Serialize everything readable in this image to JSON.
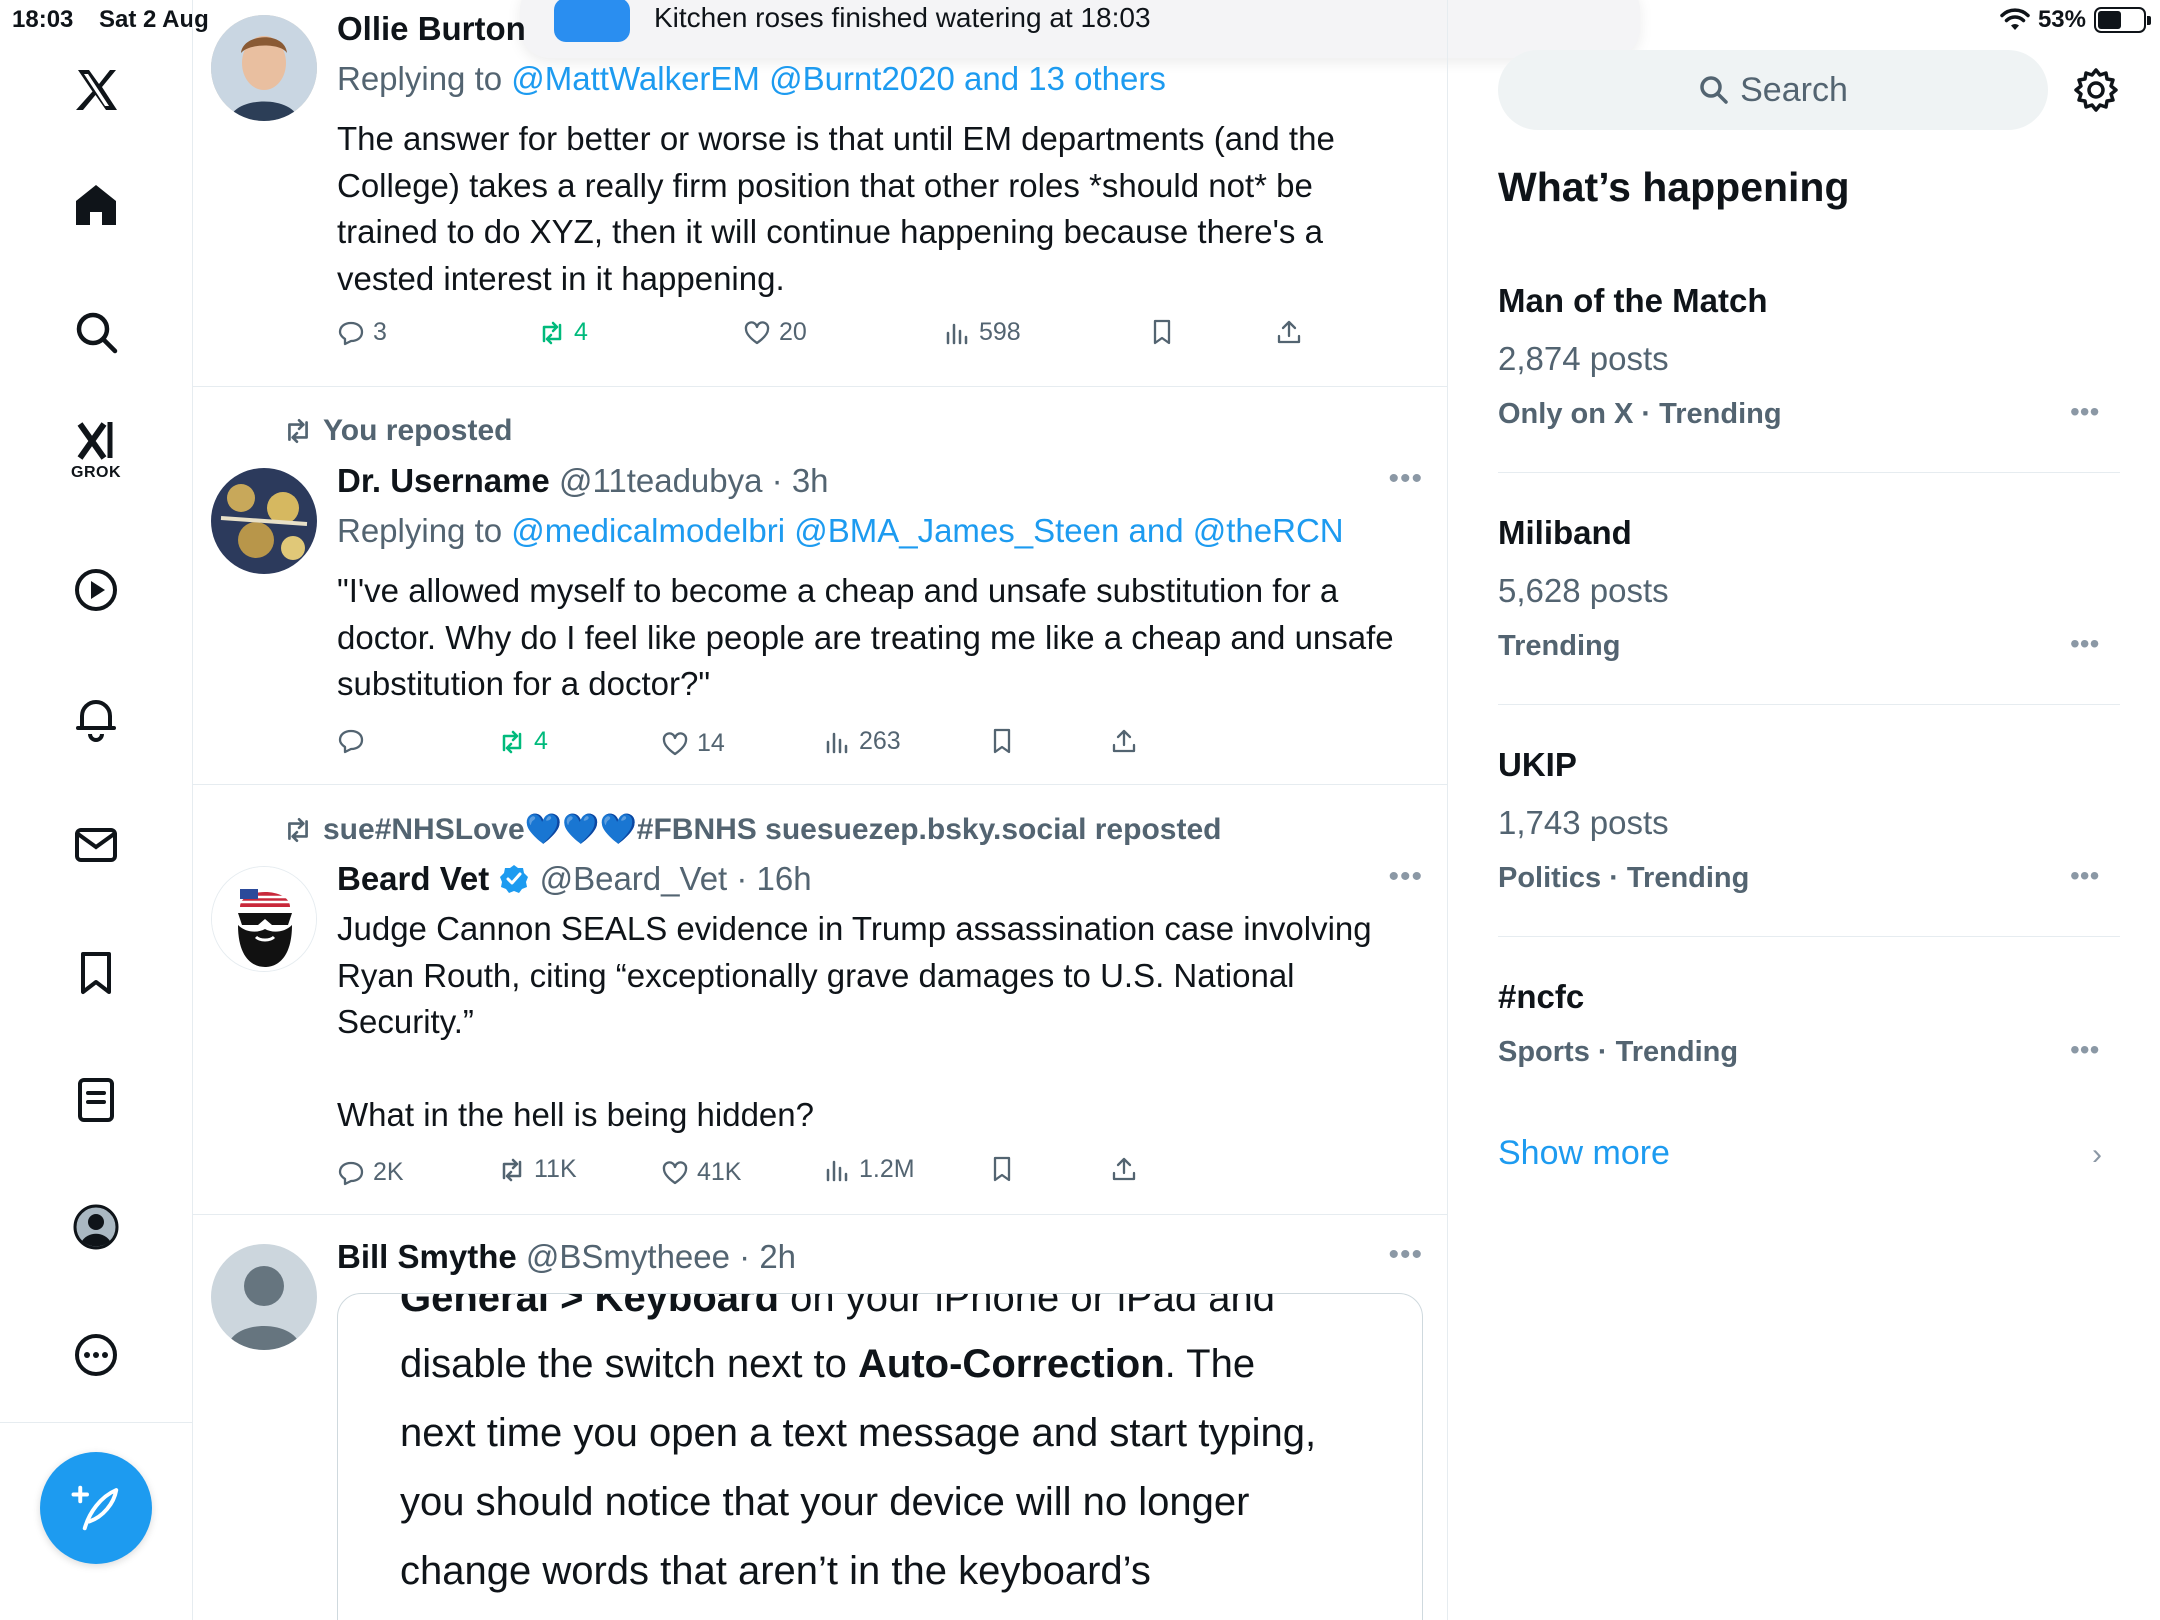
{
  "status_bar": {
    "time": "18:03",
    "date": "Sat 2 Aug",
    "battery_percent": "53%",
    "battery_level": 0.53
  },
  "notification": {
    "text": "Kitchen roses finished watering at 18:03"
  },
  "left_nav": {
    "items": [
      "x-logo",
      "home",
      "explore",
      "grok",
      "videos",
      "notifications",
      "messages",
      "bookmarks",
      "lists",
      "profile",
      "more"
    ],
    "grok_label": "GROK"
  },
  "feed": {
    "tweets": [
      {
        "name": "Ollie Burton",
        "replying_label": "Replying to",
        "replying_to": "@MattWalkerEM @Burnt2020 and 13 others",
        "body_lines": [
          "The answer for better or worse is that until EM departments (and the",
          "College) takes a really firm position that other roles *should not* be",
          "trained to do XYZ, then it will continue happening because there's a",
          "vested interest in it happening."
        ],
        "replies": "3",
        "reposts": "4",
        "likes": "20",
        "views": "598"
      },
      {
        "repost_context": "You reposted",
        "name": "Dr. Username",
        "handle": "@11teadubya",
        "time": "3h",
        "replying_label": "Replying to",
        "replying_to": "@medicalmodelbri @BMA_James_Steen and @theRCN",
        "body_lines": [
          "\"I've allowed myself to become a cheap and unsafe substitution for a",
          "doctor. Why do I feel like people are treating me like a cheap and unsafe",
          "substitution for a doctor?\""
        ],
        "replies": "",
        "reposts": "4",
        "likes": "14",
        "views": "263"
      },
      {
        "repost_context": "sue#NHSLove💙💙💙#FBNHS suesuezep.bsky.social reposted",
        "name": "Beard Vet",
        "handle": "@Beard_Vet",
        "time": "16h",
        "verified": true,
        "body_lines": [
          "Judge Cannon SEALS evidence in Trump assassination case involving",
          "Ryan Routh, citing “exceptionally grave damages to U.S. National",
          "Security.”",
          "",
          "What in the hell is being hidden?"
        ],
        "replies": "2K",
        "reposts": "11K",
        "likes": "41K",
        "views": "1.2M"
      },
      {
        "name": "Bill Smythe",
        "handle": "@BSmytheee",
        "time": "2h",
        "card_lines": {
          "line1_bold": "General > Keyboard",
          "line1_rest": " on your iPhone or iPad and",
          "line2_pre": "disable the switch next to ",
          "line2_bold": "Auto-Correction",
          "line2_post": ". The",
          "line3": "next time you open a text message and start typing,",
          "line4": "you should notice that your device will no longer",
          "line5": "change words that aren’t in the keyboard’s"
        }
      }
    ]
  },
  "sidebar": {
    "search_placeholder": "Search",
    "heading": "What’s happening",
    "trends": [
      {
        "title": "Man of the Match",
        "posts": "2,874 posts",
        "category": "Only on X · Trending"
      },
      {
        "title": "Miliband",
        "posts": "5,628 posts",
        "category": "Trending"
      },
      {
        "title": "UKIP",
        "posts": "1,743 posts",
        "category": "Politics · Trending"
      },
      {
        "title": "#ncfc",
        "posts": "",
        "category": "Sports · Trending"
      }
    ],
    "show_more": "Show more"
  },
  "colors": {
    "accent": "#1d9bf0",
    "repost_green": "#00ba7c",
    "secondary_text": "#536471",
    "divider": "#e6ecf0"
  }
}
